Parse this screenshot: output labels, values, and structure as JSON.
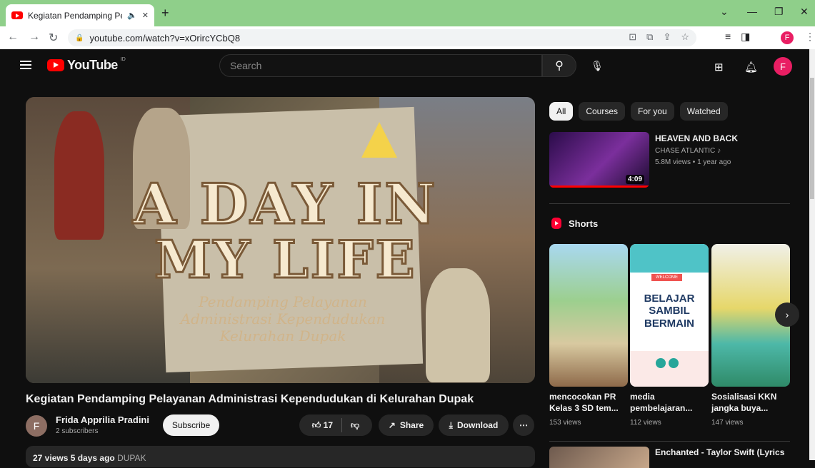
{
  "browser": {
    "tab_title": "Kegiatan Pendamping Pelaya",
    "url": "youtube.com/watch?v=xOrircYCbQ8",
    "profile_initial": "F"
  },
  "youtube": {
    "logo_text": "YouTube",
    "country_code": "ID",
    "search_placeholder": "Search",
    "avatar_initial": "F"
  },
  "video": {
    "title": "Kegiatan Pendamping Pelayanan Administrasi Kependudukan di Kelurahan Dupak",
    "thumbnail_line1": "A DAY IN",
    "thumbnail_line2": "MY LIFE",
    "thumbnail_sub": "Pendamping Pelayanan Administrasi Kependudukan Kelurahan Dupak",
    "channel_initial": "F",
    "channel_name": "Frida Apprilia Pradini",
    "subscribers": "2 subscribers",
    "subscribe_label": "Subscribe",
    "likes": "17",
    "share_label": "Share",
    "download_label": "Download",
    "views_date": "27 views  5 days ago",
    "tag": "DUPAK"
  },
  "sidebar": {
    "chips": [
      "All",
      "Courses",
      "For you",
      "Watched"
    ],
    "rec1": {
      "title": "HEAVEN AND BACK",
      "channel": "CHASE ATLANTIC",
      "meta": "5.8M views • 1 year ago",
      "duration": "4:09"
    },
    "shorts_heading": "Shorts",
    "short2_badge": "WELCOME",
    "short2_text": "BELAJAR SAMBIL BERMAIN",
    "shorts": [
      {
        "title": "mencocokan PR Kelas 3 SD tem...",
        "views": "153 views"
      },
      {
        "title": "media pembelajaran...",
        "views": "112 views"
      },
      {
        "title": "Sosialisasi KKN jangka buya...",
        "views": "147 views"
      }
    ],
    "rec2_title": "Enchanted - Taylor Swift (Lyrics"
  },
  "colors": {
    "background": "#0f0f0f",
    "brand_red": "#ff0000",
    "tabbar_green": "#8fcf8a",
    "avatar_pink": "#e91e63"
  }
}
